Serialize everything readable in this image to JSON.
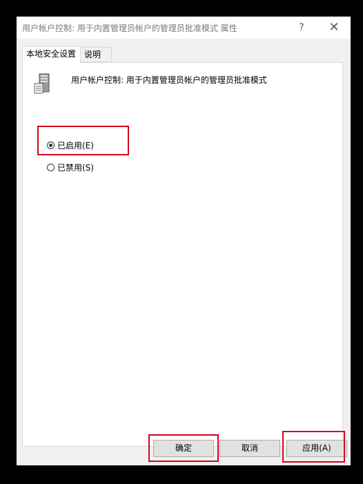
{
  "window": {
    "title": "用户帐户控制: 用于内置管理员帐户的管理员批准模式 属性",
    "help_label": "?",
    "close_label": "✕"
  },
  "tabs": [
    {
      "label": "本地安全设置",
      "active": true
    },
    {
      "label": "说明",
      "active": false
    }
  ],
  "policy": {
    "icon": "server-icon",
    "name": "用户帐户控制: 用于内置管理员帐户的管理员批准模式"
  },
  "options": [
    {
      "label": "已启用(E)",
      "checked": true
    },
    {
      "label": "已禁用(S)",
      "checked": false
    }
  ],
  "buttons": {
    "ok": "确定",
    "cancel": "取消",
    "apply": "应用(A)"
  },
  "highlight_color": "#d9001b"
}
